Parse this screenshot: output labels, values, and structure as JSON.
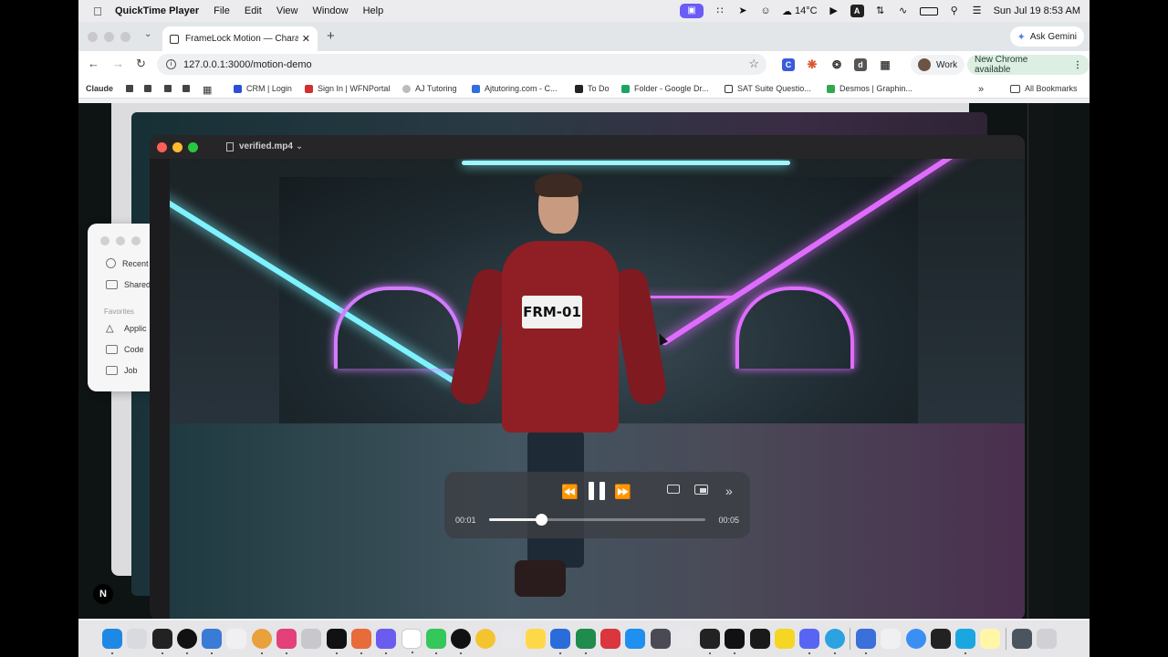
{
  "menubar": {
    "app_name": "QuickTime Player",
    "menus": [
      "File",
      "Edit",
      "View",
      "Window",
      "Help"
    ],
    "temperature": "14°C",
    "input_badge": "A",
    "clock": "Sun Jul 19  8:53 AM"
  },
  "browser": {
    "tab_title": "FrameLock Motion — Charact",
    "url": "127.0.0.1:3000/motion-demo",
    "ask_gemini": "Ask Gemini",
    "profile": "Work",
    "new_chrome": "New Chrome available",
    "bookmarks": {
      "first": "Claude",
      "items": [
        "CRM | Login",
        "Sign In | WFNPortal",
        "AJ Tutoring",
        "Ajtutoring.com - C...",
        "To Do",
        "Folder - Google Dr...",
        "SAT Suite Questio...",
        "Desmos | Graphin..."
      ],
      "all": "All Bookmarks"
    }
  },
  "finder": {
    "items": [
      "Recent",
      "Shared"
    ],
    "favorites_header": "Favorites",
    "favorites": [
      "Applic",
      "Code",
      "Job"
    ]
  },
  "quicktime": {
    "filename": "verified.mp4",
    "bib_text": "FRM-01",
    "current_time": "00:01",
    "duration": "00:05",
    "progress": 0.24
  },
  "next_badge": "N",
  "colors": {
    "neon_cyan": "#7ef3ff",
    "neon_magenta": "#e06cff",
    "jacket_red": "#8f1f24",
    "traffic_red": "#ff5f57",
    "traffic_yellow": "#febc2e",
    "traffic_green": "#28c840"
  }
}
